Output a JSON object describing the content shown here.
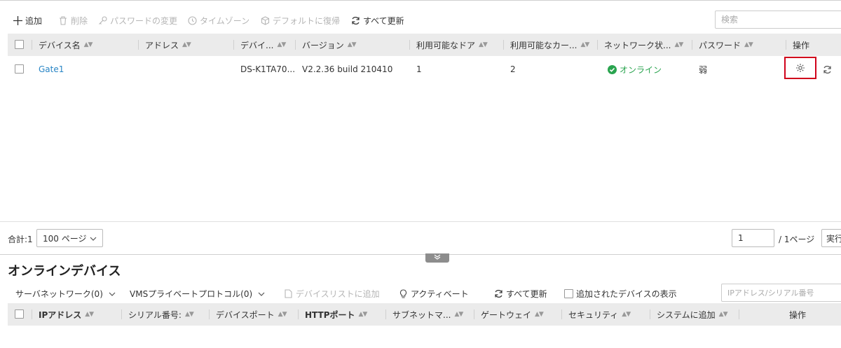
{
  "toolbar": {
    "add": "追加",
    "delete": "削除",
    "change_password": "パスワードの変更",
    "timezone": "タイムゾーン",
    "restore_default": "デフォルトに復帰",
    "refresh_all": "すべて更新",
    "search_placeholder": "検索"
  },
  "device_table": {
    "headers": [
      "デバイス名",
      "アドレス",
      "デバイ...",
      "バージョン",
      "利用可能なドア",
      "利用可能なカー...",
      "ネットワーク状...",
      "パスワード",
      "操作"
    ],
    "rows": [
      {
        "name": "Gate1",
        "address": "",
        "device_type": "DS-K1TA70...",
        "version": "V2.2.36 build 210410",
        "doors": "1",
        "card_readers": "2",
        "network_status": "オンライン",
        "password": "弱"
      }
    ]
  },
  "pager": {
    "total": "合計:1",
    "page_size": "100 ページ",
    "page_input": "1",
    "page_total": "/ 1ページ",
    "go": "実行"
  },
  "online_devices": {
    "title": "オンラインデバイス",
    "server_network": "サーバネットワーク(0)",
    "vms_protocol": "VMSプライベートプロトコル(0)",
    "add_to_list": "デバイスリストに追加",
    "activate": "アクティベート",
    "refresh_all": "すべて更新",
    "show_added": "追加されたデバイスの表示",
    "search_placeholder": "IPアドレス/シリアル番号",
    "headers": [
      "IPアドレス",
      "シリアル番号:",
      "デバイスポート",
      "HTTPポート",
      "サブネットマ...",
      "ゲートウェイ",
      "セキュリティ",
      "システムに追加",
      "操作"
    ]
  },
  "colors": {
    "accent_link": "#2a86c6",
    "online_green": "#2aa44f",
    "highlight_red": "#d0021b",
    "header_bg": "#ebebeb"
  }
}
